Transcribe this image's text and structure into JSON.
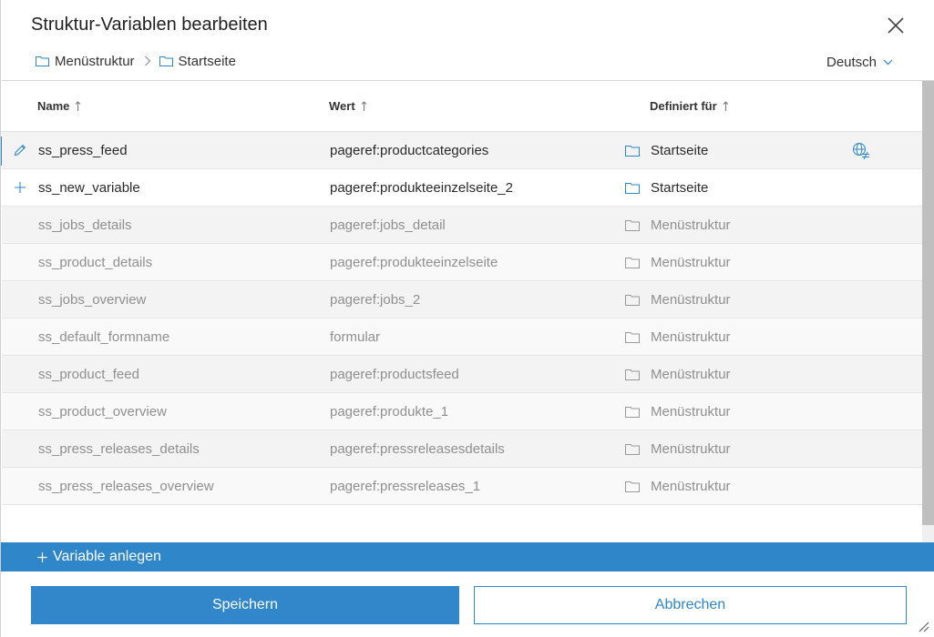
{
  "dialog": {
    "title": "Struktur-Variablen bearbeiten",
    "close_icon": "close-icon"
  },
  "breadcrumb": [
    {
      "label": "Menüstruktur",
      "icon": "folder-icon"
    },
    {
      "label": "Startseite",
      "icon": "folder-icon"
    }
  ],
  "language": {
    "selected": "Deutsch",
    "icon": "chevron-down-icon"
  },
  "table": {
    "columns": [
      {
        "label": "Name",
        "sort_icon": "sort-arrow-up-icon"
      },
      {
        "label": "Wert",
        "sort_icon": "sort-arrow-up-icon"
      },
      {
        "label": "Definiert für",
        "sort_icon": "sort-arrow-up-icon"
      }
    ],
    "rows": [
      {
        "name": "ss_press_feed",
        "value": "pageref:productcategories",
        "defined_for": "Startseite",
        "state": "active",
        "row_icon": "pencil-icon",
        "extra_icon": "language-not-equal-icon"
      },
      {
        "name": "ss_new_variable",
        "value": "pageref:produkteeinzelseite_2",
        "defined_for": "Startseite",
        "state": "normal",
        "row_icon": "plus-icon"
      },
      {
        "name": "ss_jobs_details",
        "value": "pageref:jobs_detail",
        "defined_for": "Menüstruktur",
        "state": "inherited"
      },
      {
        "name": "ss_product_details",
        "value": "pageref:produkteeinzelseite",
        "defined_for": "Menüstruktur",
        "state": "inherited"
      },
      {
        "name": "ss_jobs_overview",
        "value": "pageref:jobs_2",
        "defined_for": "Menüstruktur",
        "state": "inherited"
      },
      {
        "name": "ss_default_formname",
        "value": "formular",
        "defined_for": "Menüstruktur",
        "state": "inherited"
      },
      {
        "name": "ss_product_feed",
        "value": "pageref:productsfeed",
        "defined_for": "Menüstruktur",
        "state": "inherited"
      },
      {
        "name": "ss_product_overview",
        "value": "pageref:produkte_1",
        "defined_for": "Menüstruktur",
        "state": "inherited"
      },
      {
        "name": "ss_press_releases_details",
        "value": "pageref:pressreleasesdetails",
        "defined_for": "Menüstruktur",
        "state": "inherited"
      },
      {
        "name": "ss_press_releases_overview",
        "value": "pageref:pressreleases_1",
        "defined_for": "Menüstruktur",
        "state": "inherited"
      }
    ]
  },
  "actions": {
    "add_variable_label": "Variable anlegen",
    "add_icon": "plus-icon",
    "save_label": "Speichern",
    "cancel_label": "Abbrechen"
  },
  "colors": {
    "accent": "#2f86c8",
    "inherited_text": "#8f8f8f",
    "text": "#2a2a2a"
  }
}
